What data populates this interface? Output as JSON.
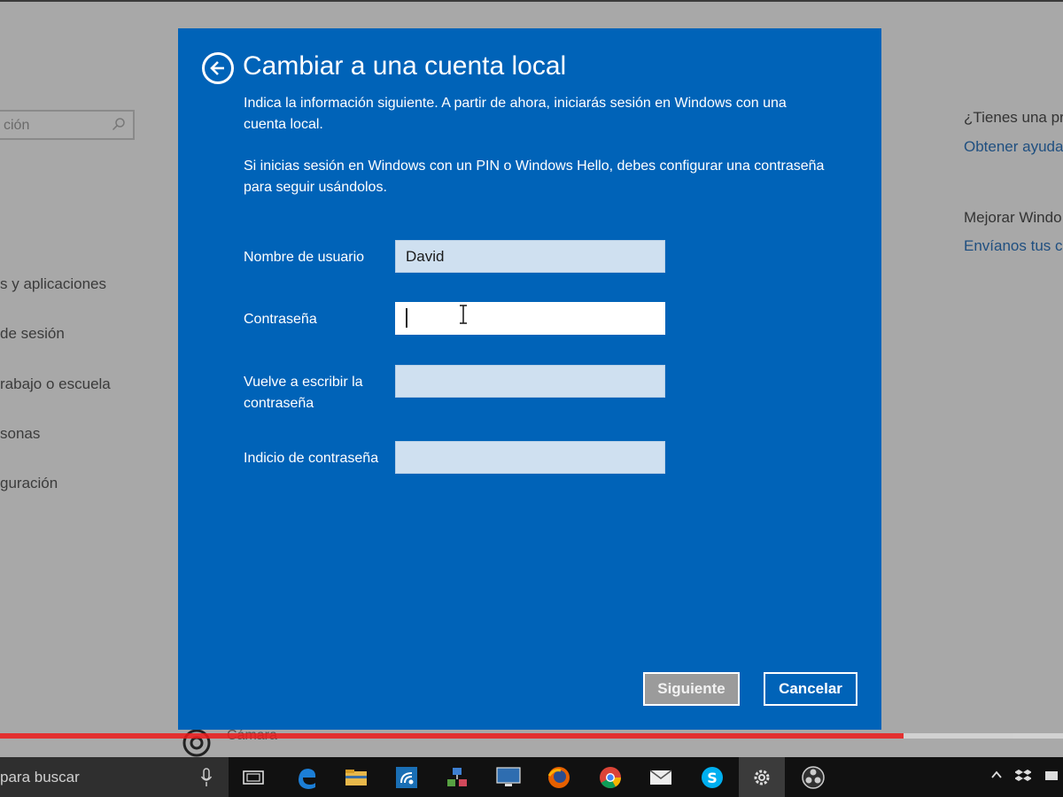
{
  "background": {
    "search_placeholder_fragment": "ción",
    "nav_items": [
      "s y aplicaciones",
      "de sesión",
      "rabajo o escuela",
      "sonas",
      "guración"
    ],
    "right_panel": {
      "question_title": "¿Tienes una pr",
      "question_link": "Obtener ayuda",
      "improve_title": "Mejorar Windo",
      "improve_link": "Envíanos tus c"
    },
    "camera_label": "Cámara"
  },
  "dialog": {
    "title": "Cambiar a una cuenta local",
    "paragraph1": "Indica la información siguiente. A partir de ahora, iniciarás sesión en Windows con una cuenta local.",
    "paragraph2": "Si inicias sesión en Windows con un PIN o Windows Hello, debes configurar una contraseña para seguir usándolos.",
    "fields": {
      "username": {
        "label": "Nombre de usuario",
        "value": "David"
      },
      "password": {
        "label": "Contraseña",
        "value": ""
      },
      "password_repeat": {
        "label": "Vuelve a escribir la contraseña",
        "value": ""
      },
      "password_hint": {
        "label": "Indicio de contraseña",
        "value": ""
      }
    },
    "buttons": {
      "next": "Siguiente",
      "cancel": "Cancelar"
    }
  },
  "video": {
    "progress_fraction": 0.85
  },
  "taskbar": {
    "search_text": "para buscar",
    "icons": [
      "task-view-icon",
      "edge-icon",
      "file-explorer-icon",
      "network-icon",
      "remote-desktop-icon",
      "monitor-icon",
      "firefox-icon",
      "chrome-icon",
      "mail-icon",
      "skype-icon",
      "settings-icon",
      "obs-icon"
    ]
  },
  "colors": {
    "dialog_blue": "#0063b8",
    "progress_red": "#ee1c1c"
  }
}
